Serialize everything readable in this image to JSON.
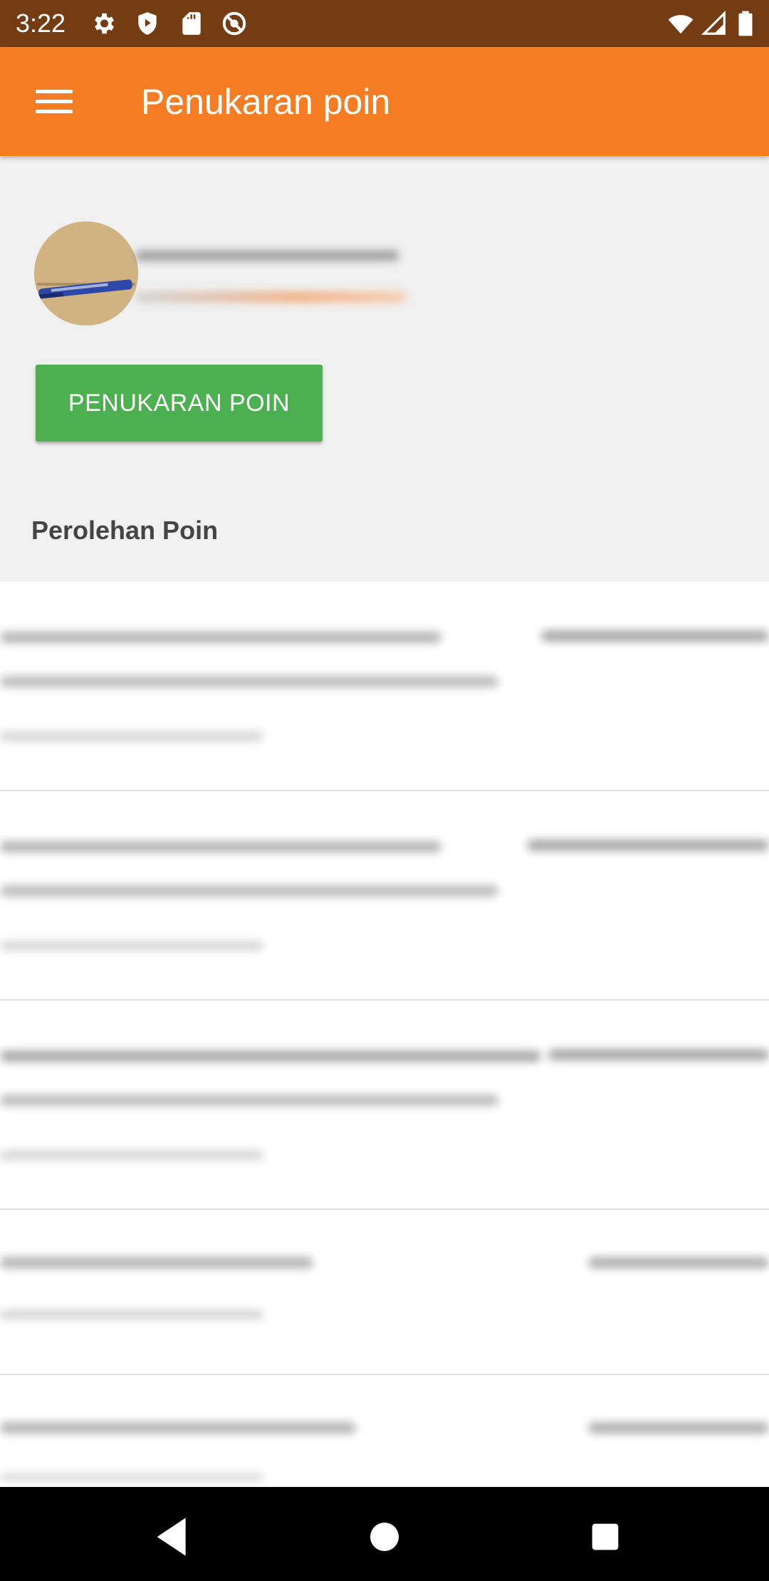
{
  "status_bar": {
    "time": "3:22",
    "icons_left": [
      "gear-icon",
      "shield-play-icon",
      "sd-card-icon",
      "no-sync-icon"
    ],
    "icons_right": [
      "wifi-icon",
      "signal-icon",
      "battery-icon"
    ]
  },
  "app_bar": {
    "menu_icon": "hamburger-menu-icon",
    "title": "Penukaran poin"
  },
  "redeem_button": {
    "label": "PENUKARAN POIN"
  },
  "section": {
    "title": "Perolehan Poin"
  },
  "nav_bar": {
    "icons": [
      "back-icon",
      "home-icon",
      "recents-icon"
    ]
  },
  "colors": {
    "status_bar": "#743c12",
    "app_bar": "#f47c22",
    "button": "#4caf50",
    "page_bg": "#f0f0f0",
    "list_bg": "#ffffff"
  }
}
